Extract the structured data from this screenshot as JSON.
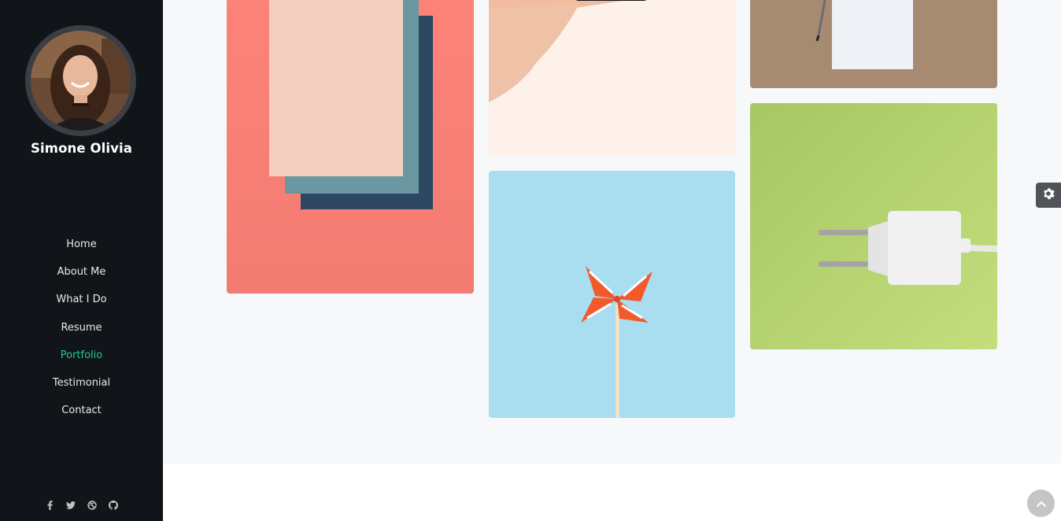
{
  "profile": {
    "name": "Simone Olivia"
  },
  "nav": {
    "items": [
      {
        "label": "Home"
      },
      {
        "label": "About Me"
      },
      {
        "label": "What I Do"
      },
      {
        "label": "Resume"
      },
      {
        "label": "Portfolio",
        "active": true
      },
      {
        "label": "Testimonial"
      },
      {
        "label": "Contact"
      }
    ]
  },
  "social": [
    "facebook-icon",
    "twitter-icon",
    "dribbble-icon",
    "github-icon"
  ],
  "colors": {
    "sidebar_bg": "#111418",
    "accent": "#20c997",
    "page_bg": "#f7f8fa"
  },
  "portfolio": {
    "items": [
      {
        "subject": "paper-sheets-on-coral"
      },
      {
        "subject": "hand-holding-phone"
      },
      {
        "subject": "paper-and-pen-on-kraft"
      },
      {
        "subject": "pinwheel-on-blue"
      },
      {
        "subject": "charger-on-green"
      }
    ]
  },
  "controls": [
    "gear-icon",
    "chevron-up-icon"
  ]
}
